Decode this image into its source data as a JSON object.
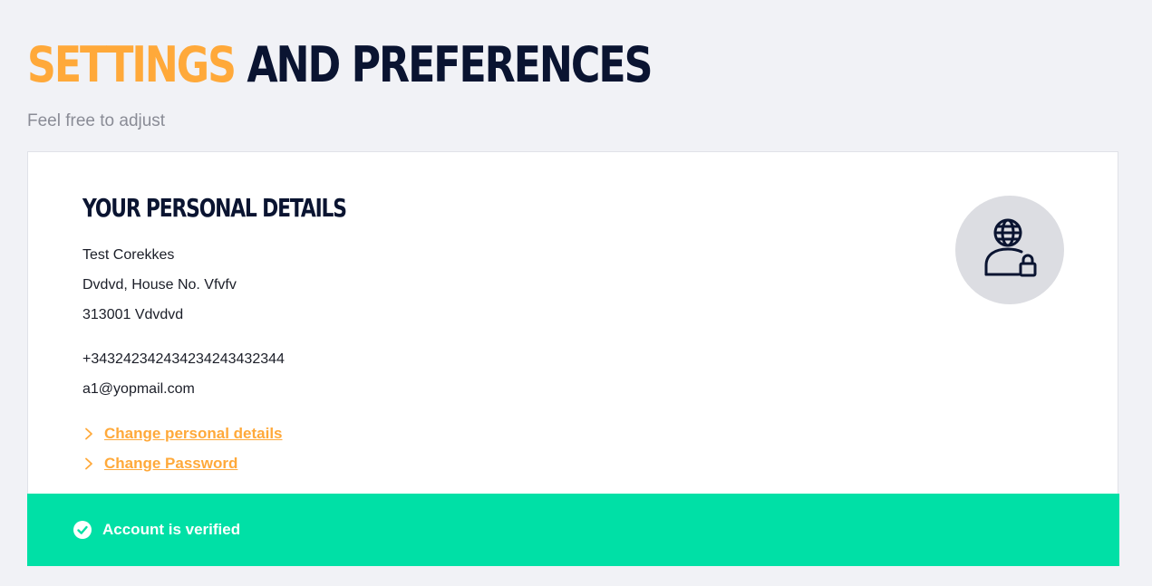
{
  "header": {
    "title_accent": "SETTINGS",
    "title_main": "AND PREFERENCES",
    "subtitle": "Feel free to adjust"
  },
  "personal_details": {
    "title": "YOUR PERSONAL DETAILS",
    "name": "Test Corekkes",
    "street": "Dvdvd, House No. Vfvfv",
    "city": "313001 Vdvdvd",
    "phone": "+343242342434234243432344",
    "email": "a1@yopmail.com",
    "icon": "user-globe-lock-icon"
  },
  "links": {
    "change_details": "Change personal details",
    "change_password": "Change Password"
  },
  "status": {
    "text": "Account is verified",
    "icon": "check-circle-icon"
  },
  "colors": {
    "accent": "#ffa93a",
    "navy": "#0a1431",
    "success": "#00e0a6",
    "background": "#f1f2f6"
  }
}
